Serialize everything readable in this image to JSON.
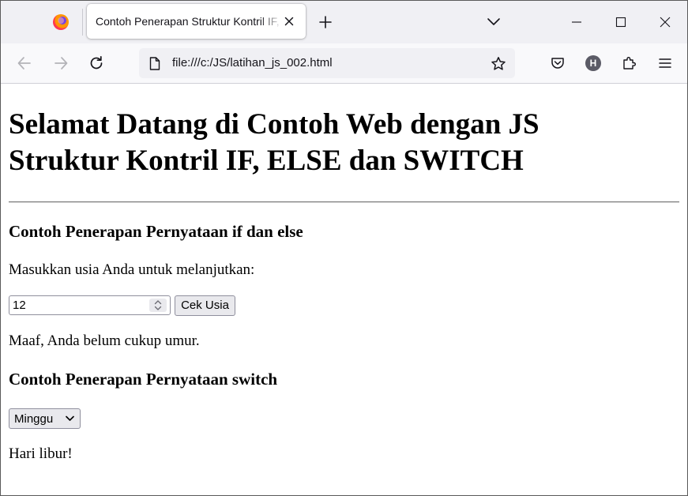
{
  "browser": {
    "tab_title": "Contoh Penerapan Struktur Kontril IF, ELSE dan SWITCH",
    "url": "file:///c:/JS/latihan_js_002.html",
    "account_initial": "H"
  },
  "icons": {
    "browser_logo": "firefox-logo",
    "tab_close": "close-icon",
    "new_tab": "plus-icon",
    "list_all_tabs": "chevron-down-icon",
    "minimize": "minimize-icon",
    "maximize": "maximize-icon",
    "close_window": "close-icon",
    "back": "arrow-left-icon",
    "forward": "arrow-right-icon",
    "reload": "reload-icon",
    "page": "page-icon",
    "bookmark": "star-icon",
    "pocket": "pocket-icon",
    "account": "account-avatar",
    "extensions": "puzzle-icon",
    "menu": "hamburger-icon"
  },
  "page": {
    "heading_line1": "Selamat Datang di Contoh Web dengan JS",
    "heading_line2": "Struktur Kontril IF, ELSE dan SWITCH",
    "section_if": {
      "title": "Contoh Penerapan Pernyataan if dan else",
      "prompt": "Masukkan usia Anda untuk melanjutkan:",
      "age_value": "12",
      "button_label": "Cek Usia",
      "result": "Maaf, Anda belum cukup umur."
    },
    "section_switch": {
      "title": "Contoh Penerapan Pernyataan switch",
      "selected_day": "Minggu",
      "result": "Hari libur!"
    }
  },
  "colors": {
    "tabstrip_bg": "#f0f0f4",
    "navbar_bg": "#f9f9fb",
    "urlbar_bg": "#f0f0f4",
    "button_bg": "#e9e9ed",
    "text": "#15141a"
  }
}
